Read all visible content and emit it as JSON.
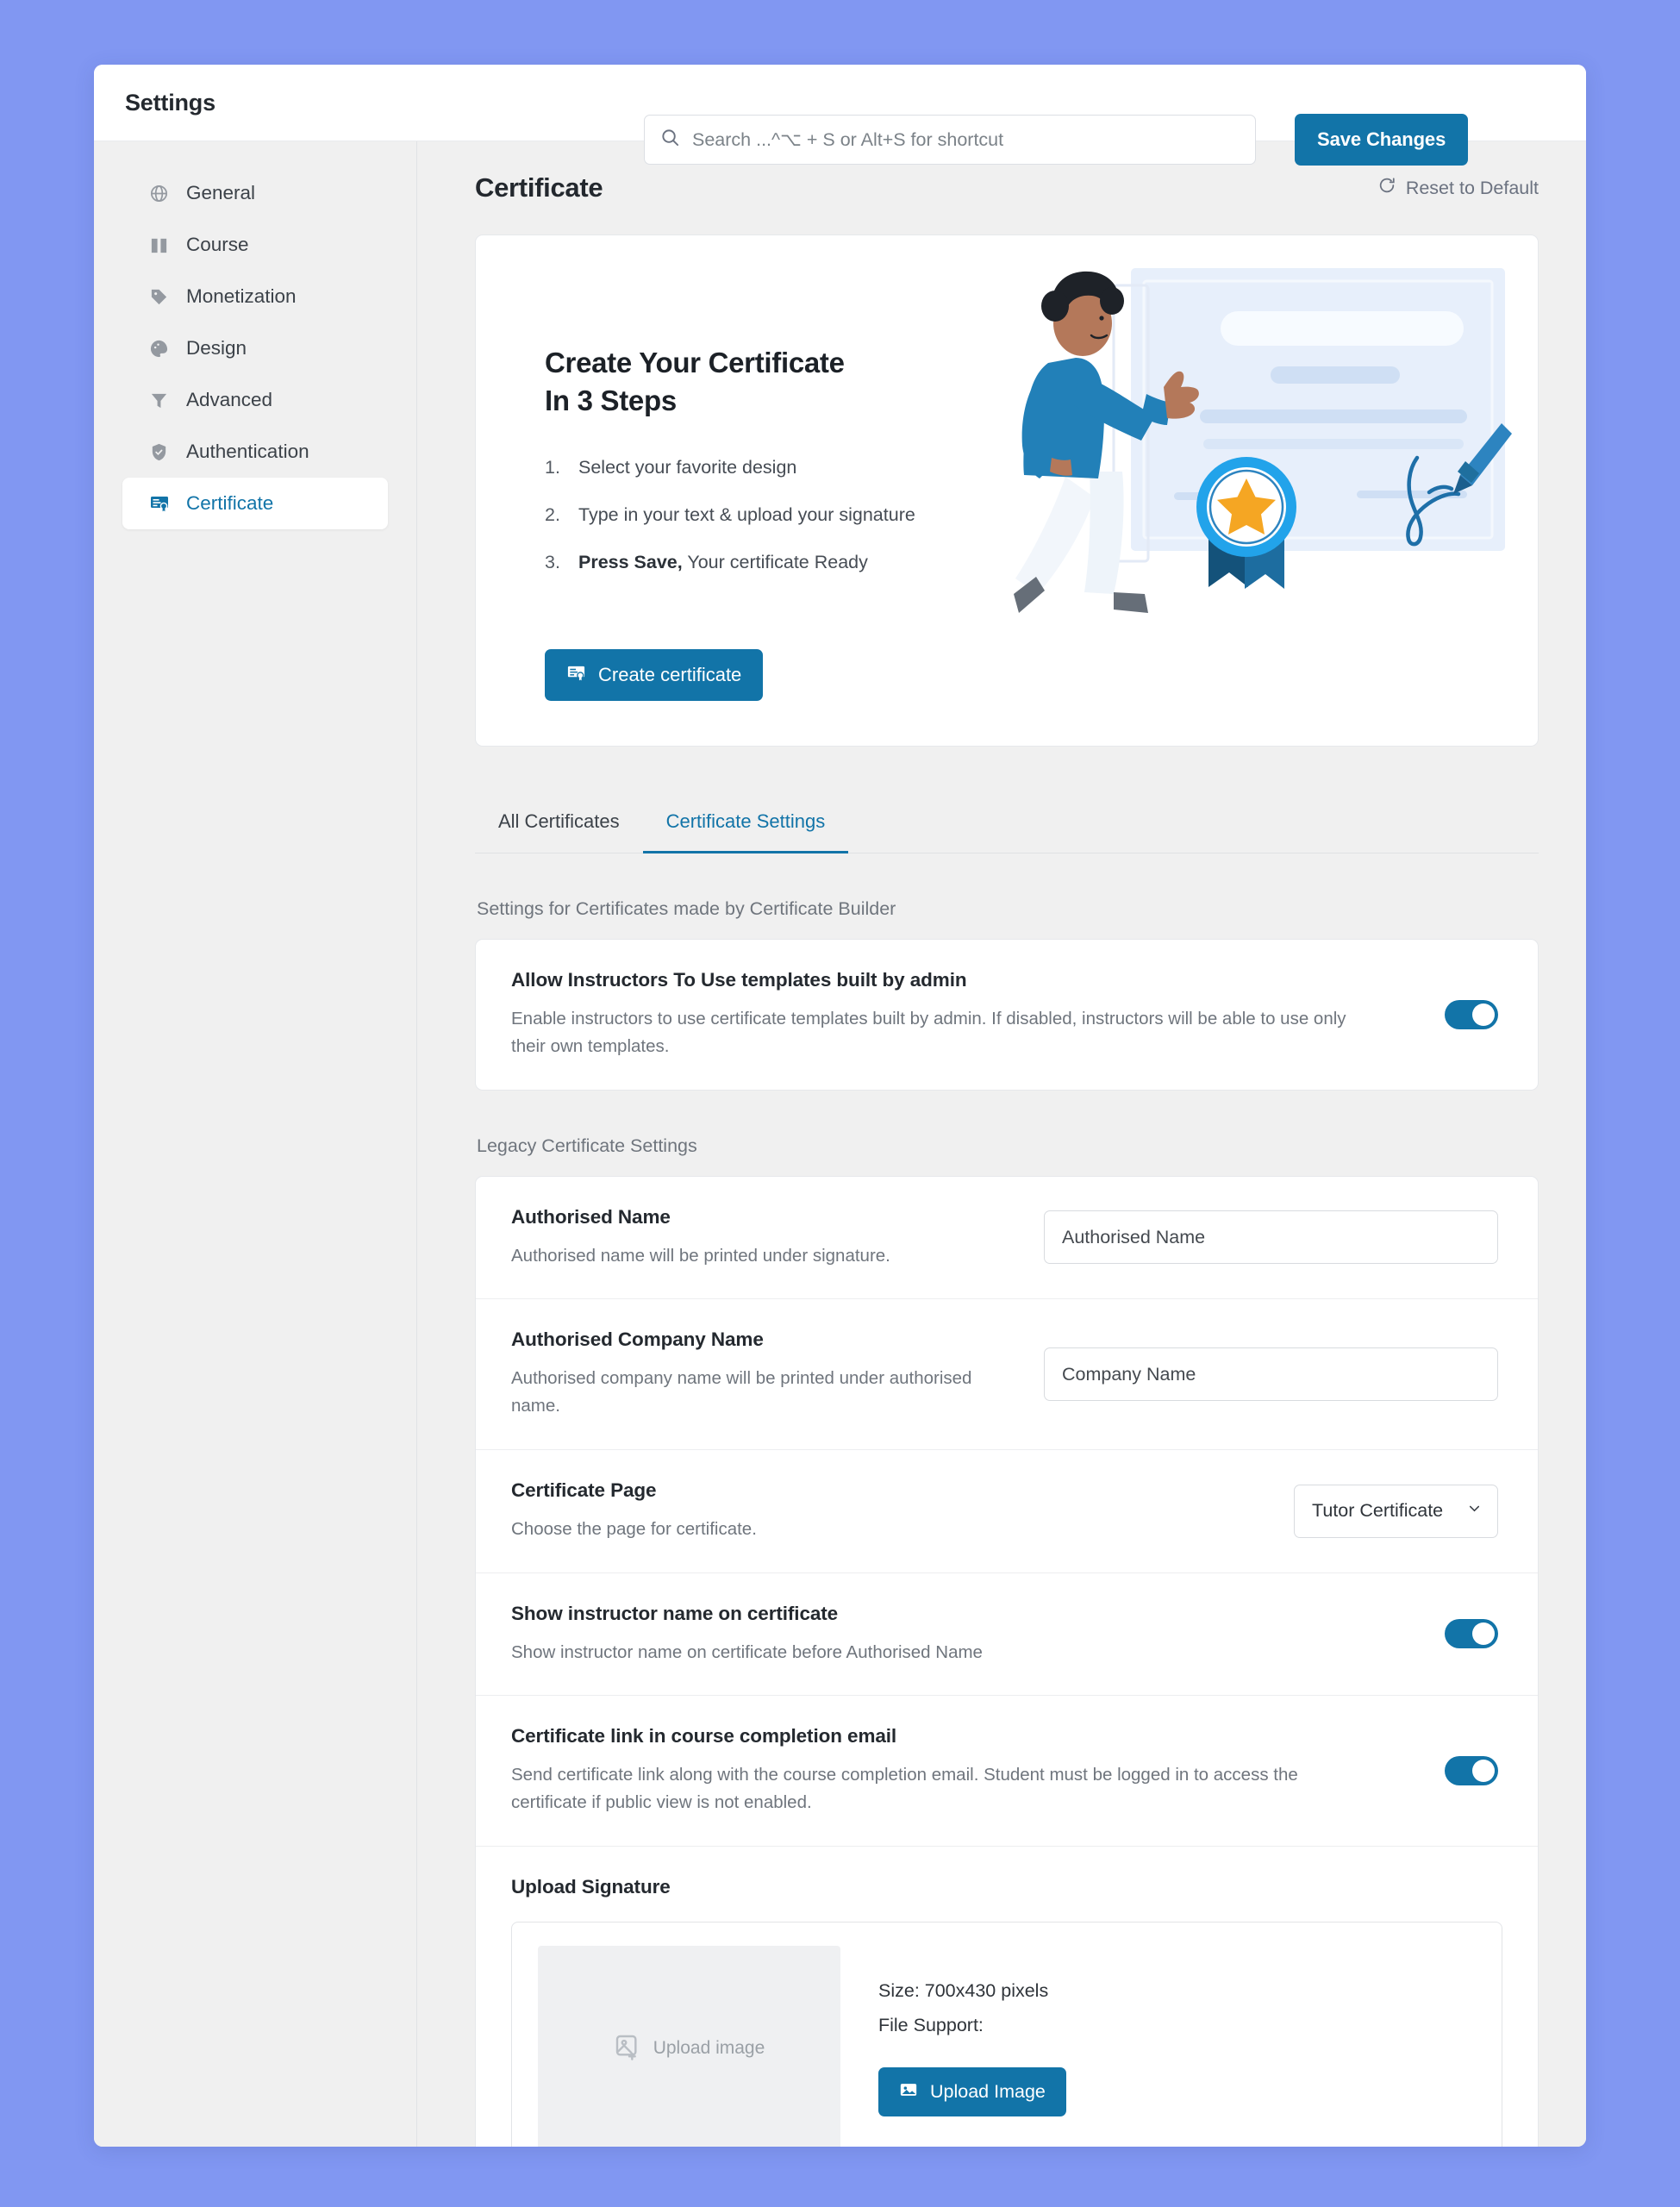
{
  "header": {
    "title": "Settings",
    "search_placeholder": "Search ...^⌥ + S or Alt+S for shortcut",
    "search_value": "",
    "save_label": "Save Changes"
  },
  "sidebar": {
    "items": [
      {
        "label": "General",
        "icon": "globe-icon",
        "active": false
      },
      {
        "label": "Course",
        "icon": "book-icon",
        "active": false
      },
      {
        "label": "Monetization",
        "icon": "price-tag-icon",
        "active": false
      },
      {
        "label": "Design",
        "icon": "palette-icon",
        "active": false
      },
      {
        "label": "Advanced",
        "icon": "funnel-icon",
        "active": false
      },
      {
        "label": "Authentication",
        "icon": "shield-icon",
        "active": false
      },
      {
        "label": "Certificate",
        "icon": "certificate-icon",
        "active": true
      }
    ]
  },
  "page": {
    "title": "Certificate",
    "reset_label": "Reset to Default",
    "reset_icon": "refresh-icon"
  },
  "hero": {
    "heading_line1": "Create Your Certificate",
    "heading_line2": "In 3 Steps",
    "steps": [
      {
        "num": "1.",
        "text": "Select your favorite design",
        "bold": ""
      },
      {
        "num": "2.",
        "text": "Type in your text & upload your signature",
        "bold": ""
      },
      {
        "num": "3.",
        "text": "Your certificate Ready",
        "bold": "Press Save,"
      }
    ],
    "cta_label": "Create certificate",
    "cta_icon": "certificate-icon"
  },
  "tabs": [
    {
      "label": "All Certificates",
      "active": false
    },
    {
      "label": "Certificate Settings",
      "active": true
    }
  ],
  "builder_section": {
    "label": "Settings for Certificates made by Certificate Builder",
    "setting": {
      "title": "Allow Instructors To Use templates built by admin",
      "desc": "Enable instructors to use certificate templates built by admin. If disabled, instructors will be able to use only their own templates.",
      "toggle_on": true
    }
  },
  "legacy_section": {
    "label": "Legacy Certificate Settings",
    "authorised_name": {
      "title": "Authorised Name",
      "desc": "Authorised name will be printed under signature.",
      "placeholder": "Authorised Name",
      "value": ""
    },
    "authorised_company": {
      "title": "Authorised Company Name",
      "desc": "Authorised company name will be printed under authorised name.",
      "placeholder": "Company Name",
      "value": ""
    },
    "certificate_page": {
      "title": "Certificate Page",
      "desc": "Choose the page for certificate.",
      "selected": "Tutor Certificate"
    },
    "show_instructor": {
      "title": "Show instructor name on certificate",
      "desc": "Show instructor name on certificate before Authorised Name",
      "toggle_on": true
    },
    "certificate_link_email": {
      "title": "Certificate link in course completion email",
      "desc": "Send certificate link along with the course completion email. Student must be logged in to access the certificate if public view is not enabled.",
      "toggle_on": true
    },
    "upload_signature": {
      "title": "Upload Signature",
      "preview_label": "Upload image",
      "size_label": "Size: 700x430 pixels",
      "file_support_label": "File Support:",
      "button_label": "Upload Image"
    }
  },
  "colors": {
    "accent": "#1274a8",
    "page_background": "#8197f2",
    "panel_background": "#f0f0f0",
    "star_gold": "#f5a623"
  }
}
